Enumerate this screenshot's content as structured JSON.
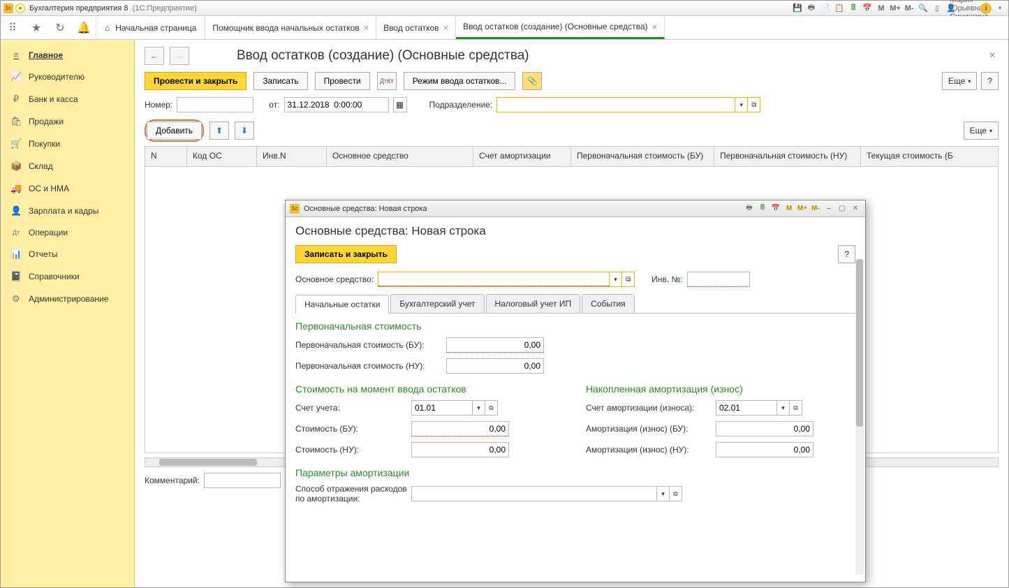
{
  "app": {
    "title": "Бухгалтерия предприятия 8",
    "subtitle": "(1С:Предприятие)",
    "user": "Мария Юрьевна Синичкина"
  },
  "top_tabs": {
    "home": "Начальная страница",
    "t1": "Помощник ввода начальных остатков",
    "t2": "Ввод остатков",
    "t3": "Ввод остатков (создание) (Основные средства)"
  },
  "sidebar": [
    {
      "icon": "≡",
      "label": "Главное",
      "active": true
    },
    {
      "icon": "📈",
      "label": "Руководителю"
    },
    {
      "icon": "₽",
      "label": "Банк и касса"
    },
    {
      "icon": "🛍",
      "label": "Продажи"
    },
    {
      "icon": "🛒",
      "label": "Покупки"
    },
    {
      "icon": "📦",
      "label": "Склад"
    },
    {
      "icon": "🚚",
      "label": "ОС и НМА"
    },
    {
      "icon": "👤",
      "label": "Зарплата и кадры"
    },
    {
      "icon": "Дт",
      "label": "Операции"
    },
    {
      "icon": "📊",
      "label": "Отчеты"
    },
    {
      "icon": "📓",
      "label": "Справочники"
    },
    {
      "icon": "⚙",
      "label": "Администрирование"
    }
  ],
  "page": {
    "title": "Ввод остатков (создание) (Основные средства)",
    "btn_post_close": "Провести и закрыть",
    "btn_save": "Записать",
    "btn_post": "Провести",
    "btn_mode": "Режим ввода остатков...",
    "more": "Еще",
    "help": "?",
    "number_label": "Номер:",
    "from_label": "от:",
    "date_value": "31.12.2018  0:00:00",
    "dept_label": "Подразделение:",
    "add": "Добавить",
    "comment_label": "Комментарий:"
  },
  "table_headers": {
    "n": "N",
    "code": "Код ОС",
    "inv": "Инв.N",
    "os": "Основное средство",
    "acc": "Счет амортизации",
    "cost_bu": "Первоначальная стоимость (БУ)",
    "cost_nu": "Первоначальная стоимость (НУ)",
    "curr": "Текущая стоимость (Б"
  },
  "popup": {
    "wintitle": "Основные средства: Новая строка",
    "h1": "Основные средства: Новая строка",
    "btn_save_close": "Записать и закрыть",
    "help": "?",
    "os_label": "Основное средство:",
    "inv_label": "Инв. №:",
    "tabs": {
      "t1": "Начальные остатки",
      "t2": "Бухгалтерский учет",
      "t3": "Налоговый учет ИП",
      "t4": "События"
    },
    "s1": "Первоначальная стоимость",
    "f1": "Первоначальная стоимость (БУ):",
    "f2": "Первоначальная стоимость (НУ):",
    "v_zero": "0,00",
    "s2": "Стоимость на момент ввода остатков",
    "s3": "Накопленная амортизация (износ)",
    "acc_label": "Счет учета:",
    "acc_val": "01.01",
    "amort_acc_label": "Счет амортизации (износа):",
    "amort_acc_val": "02.01",
    "cost_bu": "Стоимость (БУ):",
    "cost_nu": "Стоимость (НУ):",
    "amort_bu": "Амортизация (износ) (БУ):",
    "amort_nu": "Амортизация (износ) (НУ):",
    "s4": "Параметры амортизации",
    "method": "Способ отражения расходов по амортизации:"
  }
}
